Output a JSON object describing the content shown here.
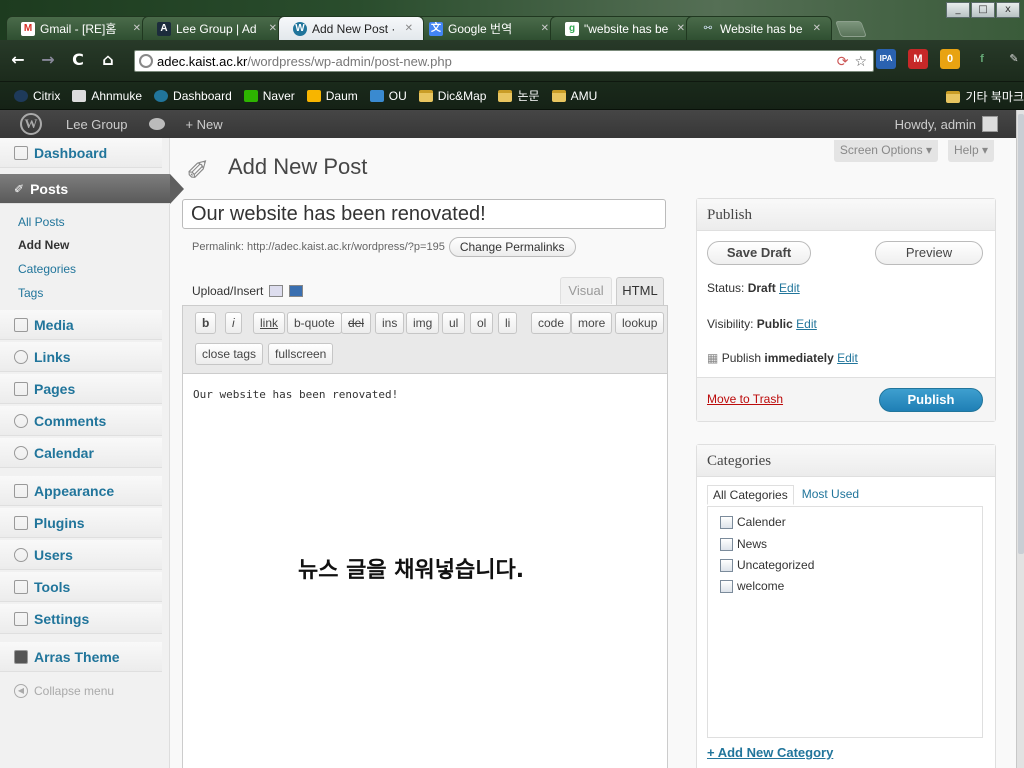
{
  "browser": {
    "tabs": [
      {
        "title": "Gmail - [RE]홈",
        "icon": "gmail-icon",
        "color": "#d93025"
      },
      {
        "title": "Lee Group | Ad",
        "icon": "site-a-icon",
        "color": "#fff"
      },
      {
        "title": "Add New Post ·",
        "icon": "wordpress-icon",
        "color": "#21759b"
      },
      {
        "title": "Google 번역",
        "icon": "google-translate-icon",
        "color": "#4285f4"
      },
      {
        "title": "\"website has be",
        "icon": "google-icon",
        "color": "#34a853"
      },
      {
        "title": "Website has be",
        "icon": "link-icon",
        "color": "#9aa"
      }
    ],
    "active_tab": 2,
    "url_host": "adec.kaist.ac.kr",
    "url_path": "/wordpress/wp-admin/post-new.php",
    "window_controls": [
      "_",
      "□",
      "x"
    ],
    "bookmarks": [
      {
        "label": "Citrix",
        "icon": "citrix-icon"
      },
      {
        "label": "Ahnmuke",
        "icon": "page-icon"
      },
      {
        "label": "Dashboard",
        "icon": "wordpress-icon"
      },
      {
        "label": "Naver",
        "icon": "naver-icon"
      },
      {
        "label": "Daum",
        "icon": "daum-icon"
      },
      {
        "label": "OU",
        "icon": "ou-icon"
      },
      {
        "label": "Dic&Map",
        "icon": "folder-icon"
      },
      {
        "label": "논문",
        "icon": "folder-icon"
      },
      {
        "label": "AMU",
        "icon": "folder-icon"
      }
    ],
    "bookmarks_other": "기타 북마크",
    "extension_ipa_label": "IPA",
    "extension_badge": "0"
  },
  "adminbar": {
    "site_name": "Lee Group",
    "new_label": "+ New",
    "howdy": "Howdy, admin"
  },
  "menu": {
    "dashboard": "Dashboard",
    "posts": "Posts",
    "posts_sub": [
      "All Posts",
      "Add New",
      "Categories",
      "Tags"
    ],
    "media": "Media",
    "links": "Links",
    "pages": "Pages",
    "comments": "Comments",
    "calendar": "Calendar",
    "appearance": "Appearance",
    "plugins": "Plugins",
    "users": "Users",
    "tools": "Tools",
    "settings": "Settings",
    "arras_theme": "Arras Theme",
    "collapse": "Collapse menu"
  },
  "main": {
    "screen_options": "Screen Options ▾",
    "help": "Help ▾",
    "page_title": "Add New Post",
    "post_title_value": "Our website has been renovated!",
    "permalink_label": "Permalink: http://adec.kaist.ac.kr/wordpress/?p=195",
    "change_permalinks": "Change Permalinks",
    "upload_insert": "Upload/Insert",
    "tab_visual": "Visual",
    "tab_html": "HTML",
    "quicktags_row1": [
      "b",
      "i",
      "link",
      "b-quote",
      "del",
      "ins",
      "img",
      "ul",
      "ol",
      "li",
      "code",
      "more",
      "lookup"
    ],
    "quicktags_row2": [
      "close tags",
      "fullscreen"
    ],
    "editor_content": "Our website has been renovated!"
  },
  "publish": {
    "title": "Publish",
    "save_draft": "Save Draft",
    "preview": "Preview",
    "status_label": "Status: ",
    "status_value": "Draft",
    "visibility_label": "Visibility: ",
    "visibility_value": "Public",
    "publish_label": "Publish ",
    "publish_value": "immediately",
    "edit": "Edit",
    "move_to_trash": "Move to Trash",
    "publish_button": "Publish"
  },
  "categories": {
    "title": "Categories",
    "tab_all": "All Categories",
    "tab_used": "Most Used",
    "items": [
      "Calender",
      "News",
      "Uncategorized",
      "welcome"
    ],
    "add_new": "+ Add New Category"
  },
  "overlay_caption": "뉴스 글을 채워넣습니다."
}
